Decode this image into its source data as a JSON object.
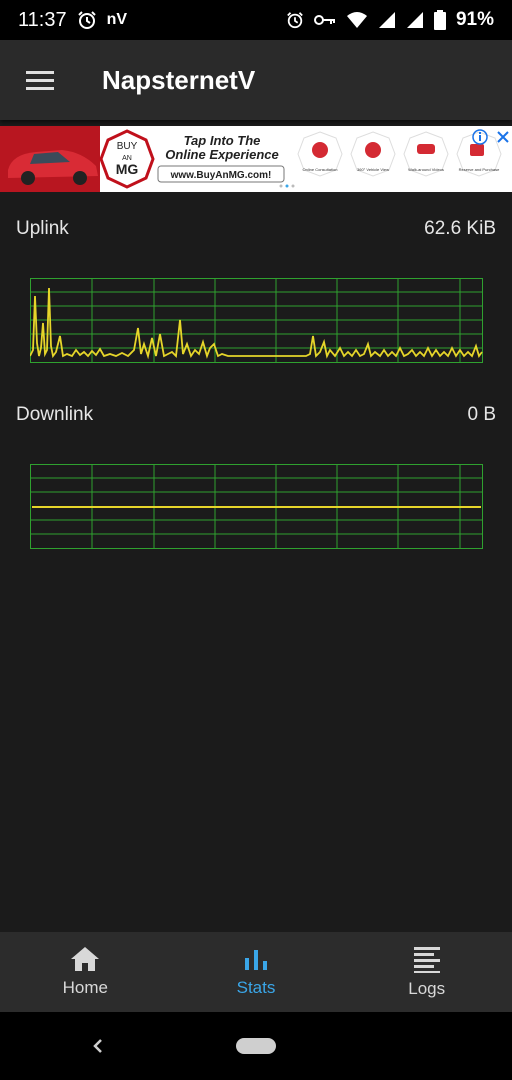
{
  "status_bar": {
    "time": "11:37",
    "app_indicator": "nV",
    "battery": "91%",
    "icons": [
      "alarm-icon",
      "alarm-icon",
      "vpn-key-icon",
      "wifi-icon",
      "signal-icon",
      "signal-icon",
      "battery-icon"
    ]
  },
  "app_bar": {
    "title": "NapsternetV",
    "menu_icon": "menu-icon"
  },
  "ad": {
    "brand_badge_line1": "BUY",
    "brand_badge_line2": "AN",
    "brand_badge_line3": "MG",
    "headline_line1": "Tap Into The",
    "headline_line2": "Online Experience",
    "url": "www.BuyAnMG.com!",
    "features": [
      "Online Consultation",
      "360° Vehicle View",
      "Walk-around Videos",
      "Reserve and Purchase"
    ],
    "ad_choices_icon": "info-icon",
    "close_icon": "close-icon"
  },
  "stats": {
    "uplink_label": "Uplink",
    "uplink_value": "62.6 KiB",
    "downlink_label": "Downlink",
    "downlink_value": "0 B"
  },
  "colors": {
    "grid": "#2fa12f",
    "line": "#e6d52a",
    "active_tab": "#3aa6e8",
    "inactive_tab": "#d8d8d8"
  },
  "bottom_nav": {
    "items": [
      {
        "label": "Home",
        "icon": "home-icon",
        "active": false
      },
      {
        "label": "Stats",
        "icon": "bar-chart-icon",
        "active": true
      },
      {
        "label": "Logs",
        "icon": "logs-icon",
        "active": false
      }
    ]
  },
  "system_nav": {
    "back_icon": "back-icon",
    "home_icon": "home-pill-icon"
  }
}
